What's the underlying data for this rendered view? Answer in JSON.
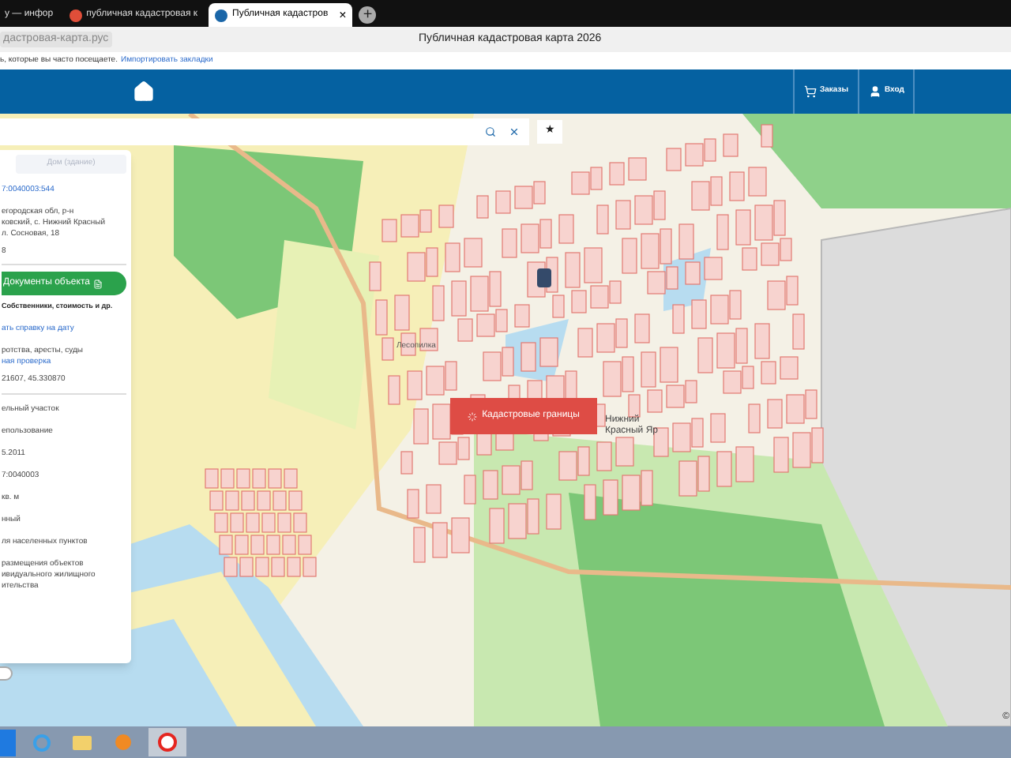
{
  "browser": {
    "tabs": [
      {
        "title": "у — инфор",
        "selected": false,
        "kind": "plain"
      },
      {
        "title": "публичная кадастровая к",
        "selected": false,
        "kind": "red"
      },
      {
        "title": "Публичная кадастров",
        "selected": true,
        "kind": "blue"
      }
    ],
    "new_tab": "+",
    "close": "×",
    "address": "дастровая-карта.рус",
    "page_title": "Публичная кадастровая карта 2026",
    "bookmarks_hint": "ь, которые вы часто посещаете.",
    "bookmarks_link": "Импортировать закладки"
  },
  "header": {
    "buttons": [
      {
        "label": "Заказы",
        "kind": "cart"
      },
      {
        "label": "Вход",
        "kind": "user"
      }
    ]
  },
  "search": {
    "star": "★"
  },
  "panel": {
    "tab": {
      "label": "Дом (здание)",
      "disabled": true
    },
    "number": "7:0040003:544",
    "address": [
      "егородская обл, р-н",
      "ковский, с. Нижний Красный",
      "л. Сосновая, 18"
    ],
    "note": "8",
    "docs_button": "Документы объекта",
    "docs_hint": "Собственники, стоимость и др.",
    "report_link": "ать справку на дату",
    "checks": "ротства, аресты, суды",
    "check_link": "ная проверка",
    "coords": "21607, 45.330870",
    "fields": [
      {
        "lines": [
          "ельный участок"
        ]
      },
      {
        "lines": [
          "епользование"
        ]
      },
      {
        "lines": [
          "5.2011"
        ]
      },
      {
        "lines": [
          "7:0040003"
        ]
      },
      {
        "lines": [
          "кв. м"
        ]
      },
      {
        "lines": [
          "нный"
        ]
      },
      {
        "lines": [
          "ля населенных пунктов"
        ]
      },
      {
        "lines": [
          "размещения объектов",
          "ивидуального жилищного",
          "ительства"
        ]
      }
    ],
    "toggle_on": false
  },
  "map": {
    "labels": [
      {
        "text": "Лесопилка"
      },
      {
        "text": "Нижний"
      },
      {
        "text": "Красный Яр"
      }
    ],
    "boundaries_button": "Кадастровые границы",
    "copyright": "©"
  },
  "taskbar": {
    "apps": [
      {
        "kind": "ie",
        "selected": false
      },
      {
        "kind": "folder",
        "selected": false
      },
      {
        "kind": "media",
        "selected": false
      },
      {
        "kind": "yandex",
        "selected": true
      }
    ]
  }
}
